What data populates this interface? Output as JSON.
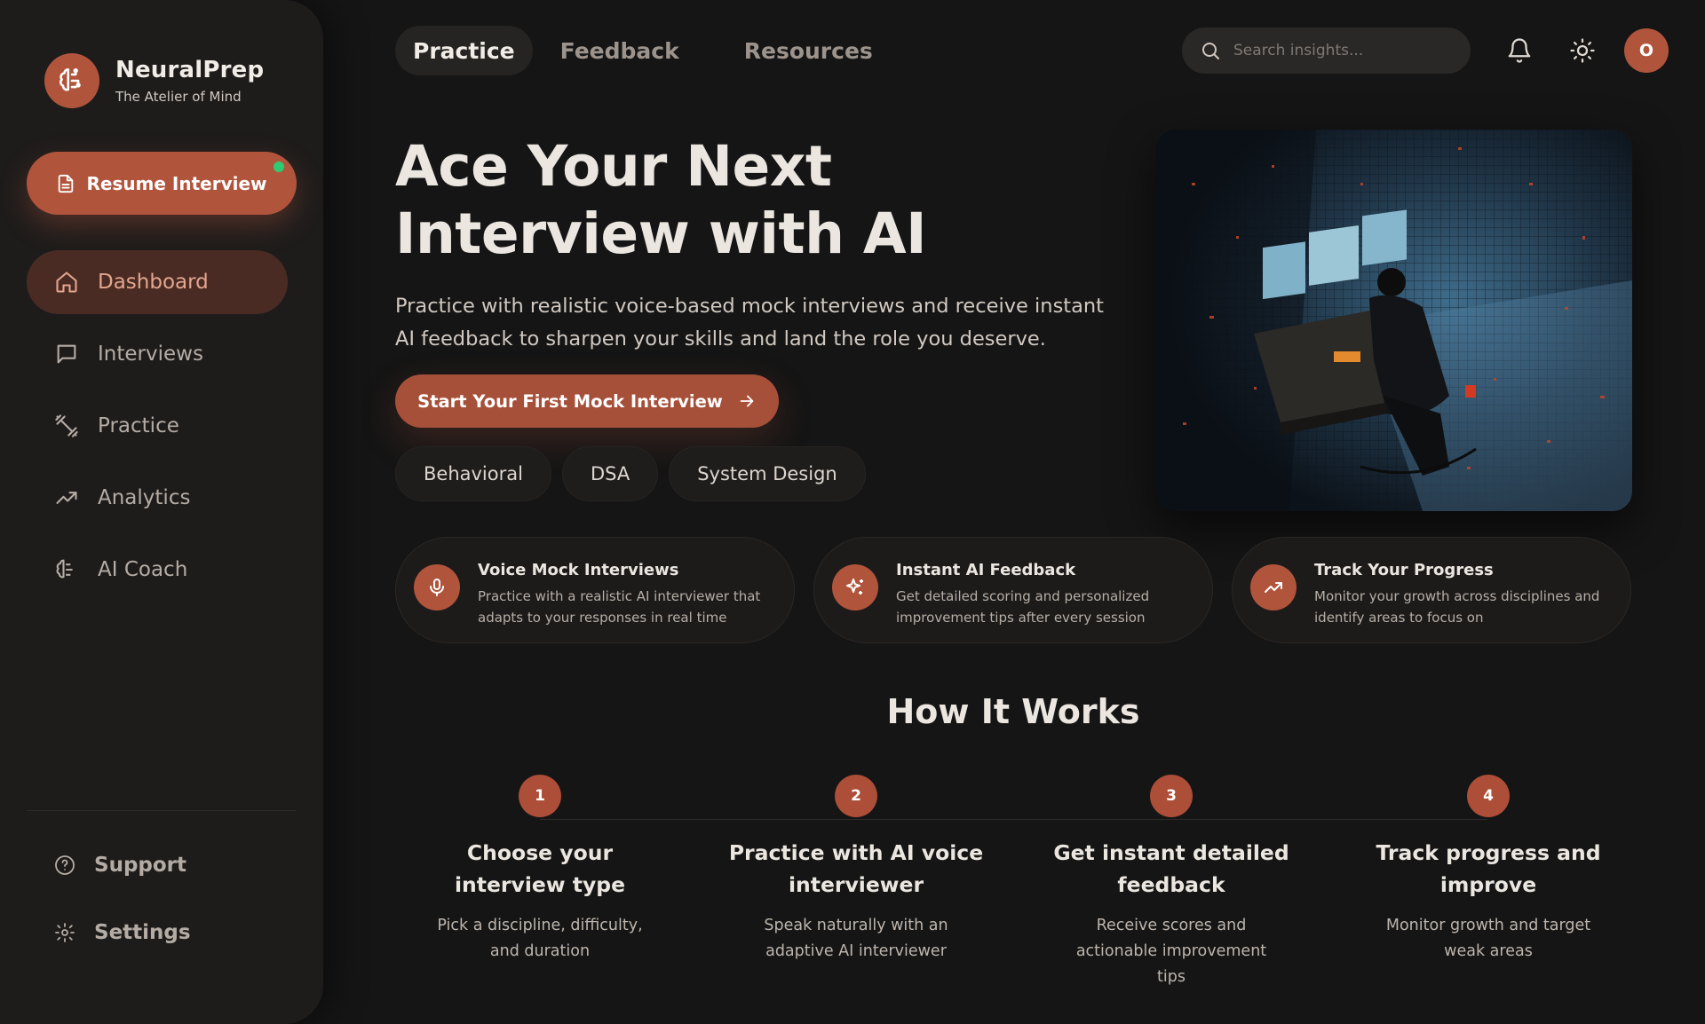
{
  "brand": {
    "name": "NeuralPrep",
    "tagline": "The Atelier of Mind",
    "logo_icon": "brain-icon"
  },
  "sidebar": {
    "resume_label": "Resume Interview",
    "items": [
      {
        "label": "Dashboard",
        "icon": "home-icon",
        "active": true
      },
      {
        "label": "Interviews",
        "icon": "chat-icon"
      },
      {
        "label": "Practice",
        "icon": "dumbbell-icon"
      },
      {
        "label": "Analytics",
        "icon": "trending-up-icon"
      },
      {
        "label": "AI Coach",
        "icon": "brain-icon"
      }
    ],
    "bottom": [
      {
        "label": "Support",
        "icon": "help-circle-icon"
      },
      {
        "label": "Settings",
        "icon": "gear-icon"
      }
    ]
  },
  "topnav": {
    "tabs": [
      {
        "label": "Practice",
        "active": true
      },
      {
        "label": "Feedback"
      },
      {
        "label": "Resources"
      }
    ],
    "search_placeholder": "Search insights...",
    "avatar_initial": "O"
  },
  "hero": {
    "title": "Ace Your Next Interview with AI",
    "subtitle": "Practice with realistic voice-based mock interviews and receive instant AI feedback to sharpen your skills and land the role you deserve.",
    "cta_label": "Start Your First Mock Interview",
    "chips": [
      "Behavioral",
      "DSA",
      "System Design"
    ]
  },
  "features": [
    {
      "title": "Voice Mock Interviews",
      "desc": "Practice with a realistic AI interviewer that adapts to your responses in real time",
      "icon": "microphone-icon"
    },
    {
      "title": "Instant AI Feedback",
      "desc": "Get detailed scoring and personalized improvement tips after every session",
      "icon": "sparkles-icon"
    },
    {
      "title": "Track Your Progress",
      "desc": "Monitor your growth across disciplines and identify areas to focus on",
      "icon": "trending-up-icon"
    }
  ],
  "how": {
    "title": "How It Works",
    "steps": [
      {
        "num": "1",
        "title": "Choose your interview type",
        "desc": "Pick a discipline, difficulty, and duration"
      },
      {
        "num": "2",
        "title": "Practice with AI voice interviewer",
        "desc": "Speak naturally with an adaptive AI interviewer"
      },
      {
        "num": "3",
        "title": "Get instant detailed feedback",
        "desc": "Receive scores and actionable improvement tips"
      },
      {
        "num": "4",
        "title": "Track progress and improve",
        "desc": "Monitor growth and target weak areas"
      }
    ]
  },
  "colors": {
    "accent": "#b1543c",
    "background": "#151515",
    "sidebar": "#1e1c1b",
    "online_dot": "#2ecc71"
  }
}
